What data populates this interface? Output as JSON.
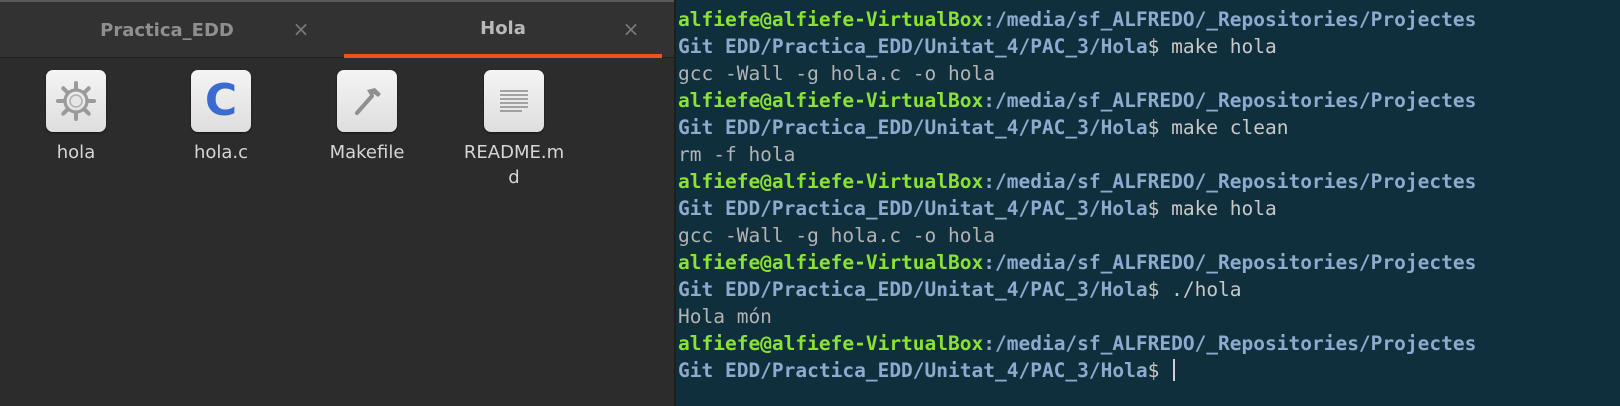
{
  "file_manager": {
    "tabs": [
      {
        "label": "Practica_EDD",
        "close": "×"
      },
      {
        "label": "Hola",
        "close": "×"
      }
    ],
    "files": [
      {
        "name": "hola",
        "icon": "gear-icon"
      },
      {
        "name": "hola.c",
        "icon": "c-source-icon",
        "glyph": "C"
      },
      {
        "name": "Makefile",
        "icon": "hammer-icon"
      },
      {
        "name": "README.md",
        "icon": "text-document-icon"
      }
    ]
  },
  "terminal": {
    "user": "alfiefe@alfiefe-VirtualBox",
    "path_line1": ":/media/sf_ALFREDO/_Repositories/Projectes",
    "path_line2": "Git EDD/Practica_EDD/Unitat_4/PAC_3/Hola",
    "prompt_char": "$",
    "cmd1": " make hola",
    "out1": "gcc -Wall -g hola.c -o hola",
    "cmd2": " make clean",
    "out2": "rm -f hola",
    "cmd3": " make hola",
    "out3": "gcc -Wall -g hola.c -o hola",
    "cmd4": " ./hola",
    "out4": "Hola món",
    "cmd5": " "
  },
  "colors": {
    "accent": "#e95420",
    "terminal_bg": "#102f3c",
    "prompt_user": "#8ae234",
    "prompt_path": "#8fa9cf"
  }
}
